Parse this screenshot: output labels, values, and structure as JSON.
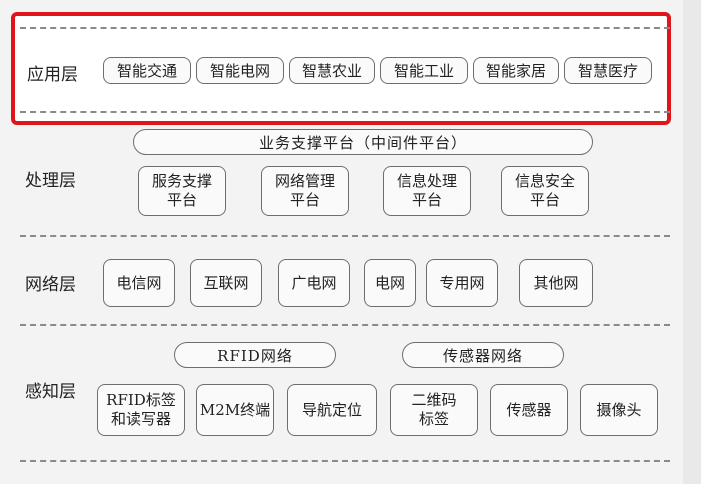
{
  "application_layer": {
    "label": "应用层",
    "items": [
      "智能交通",
      "智能电网",
      "智慧农业",
      "智能工业",
      "智能家居",
      "智慧医疗"
    ]
  },
  "processing_layer": {
    "label": "处理层",
    "platform": "业务支撑平台（中间件平台）",
    "items": [
      {
        "line1": "服务支撑",
        "line2": "平台"
      },
      {
        "line1": "网络管理",
        "line2": "平台"
      },
      {
        "line1": "信息处理",
        "line2": "平台"
      },
      {
        "line1": "信息安全",
        "line2": "平台"
      }
    ]
  },
  "network_layer": {
    "label": "网络层",
    "items": [
      "电信网",
      "互联网",
      "广电网",
      "电网",
      "专用网",
      "其他网"
    ]
  },
  "perception_layer": {
    "label": "感知层",
    "groups": [
      "RFID网络",
      "传感器网络"
    ],
    "items": [
      {
        "line1": "RFID标签",
        "line2": "和读写器"
      },
      {
        "line1": "M2M终端",
        "line2": ""
      },
      {
        "line1": "导航定位",
        "line2": ""
      },
      {
        "line1": "二维码",
        "line2": "标签"
      },
      {
        "line1": "传感器",
        "line2": ""
      },
      {
        "line1": "摄像头",
        "line2": ""
      }
    ]
  }
}
